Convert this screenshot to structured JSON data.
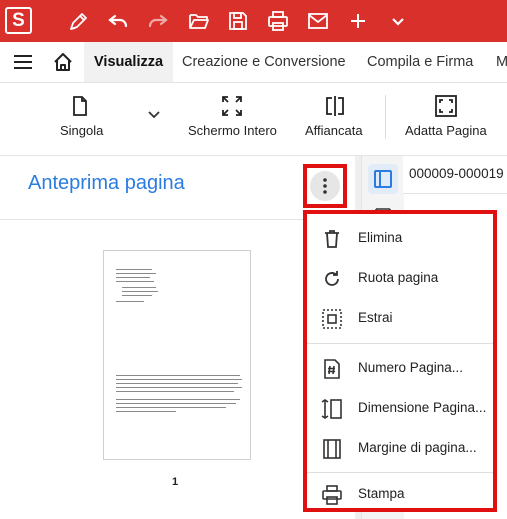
{
  "app": {
    "logo": "S"
  },
  "titlebar": {
    "icons": [
      "pen-icon",
      "undo-icon",
      "redo-icon",
      "open-folder-icon",
      "save-icon",
      "print-icon",
      "mail-icon",
      "plus-icon",
      "chevron-down-icon"
    ],
    "color": "#d9302c"
  },
  "menu_tabs": [
    "Visualizza",
    "Creazione e Conversione",
    "Compila e Firma",
    "M"
  ],
  "toolbar": {
    "single": "Singola",
    "fullscreen": "Schermo Intero",
    "side_by_side": "Affiancata",
    "fit_page": "Adatta Pagina"
  },
  "panel": {
    "title": "Anteprima pagina",
    "page_number": "1",
    "accent": "#2a7ce0"
  },
  "document_tab": "000009-000019",
  "context_menu": {
    "delete": "Elimina",
    "rotate": "Ruota pagina",
    "extract": "Estrai",
    "page_number": "Numero Pagina...",
    "page_size": "Dimensione Pagina...",
    "page_margins": "Margine di pagina...",
    "print": "Stampa",
    "highlight": "#e01010"
  }
}
